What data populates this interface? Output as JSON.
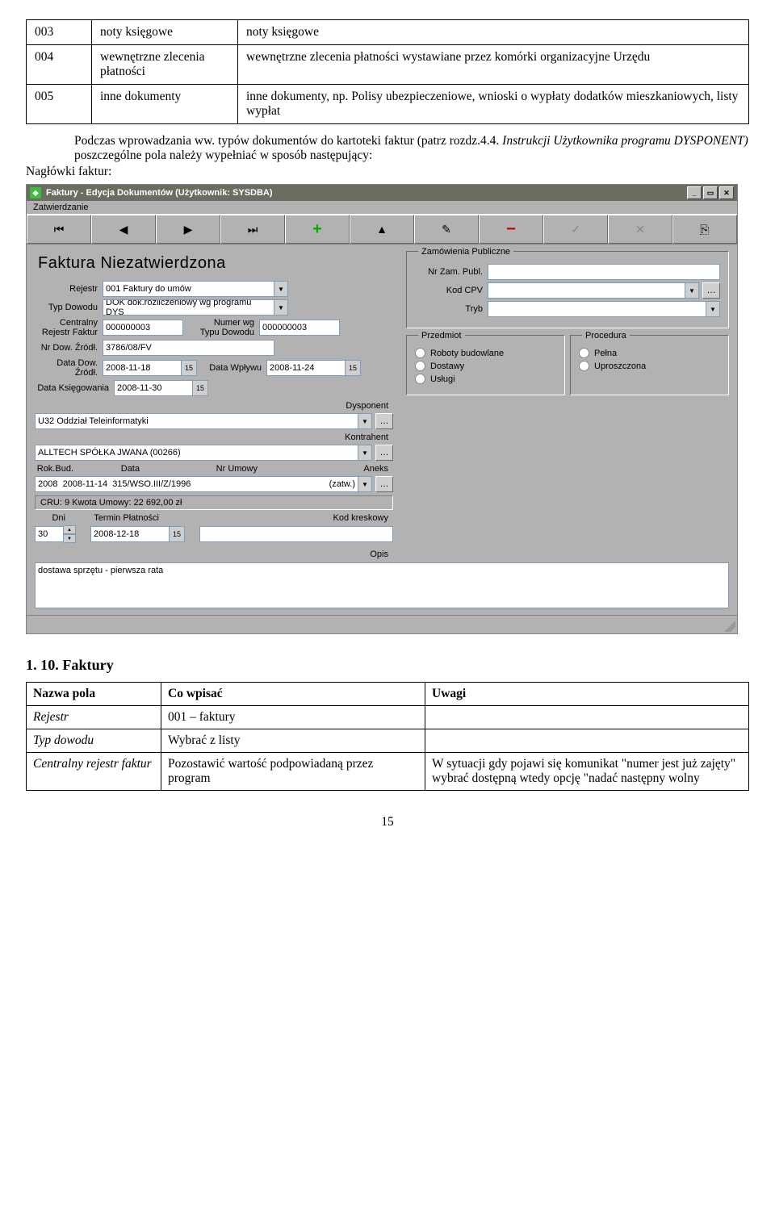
{
  "table1": {
    "rows": [
      {
        "c1": "003",
        "c2": "noty księgowe",
        "c3": "noty księgowe"
      },
      {
        "c1": "004",
        "c2": "wewnętrzne zlecenia płatności",
        "c3": "wewnętrzne zlecenia płatności wystawiane przez komórki organizacyjne Urzędu"
      },
      {
        "c1": "005",
        "c2": "inne dokumenty",
        "c3": "inne dokumenty, np. Polisy ubezpieczeniowe, wnioski o wypłaty dodatków mieszkaniowych, listy wypłat"
      }
    ]
  },
  "para1_a": "Podczas wprowadzania ww. typów dokumentów do kartoteki faktur (patrz rozdz.4.4.",
  "para1_b": "Instrukcji Użytkownika programu DYSPONENT)",
  "para1_c": " poszczególne pola należy wypełniać w sposób następujący:",
  "para2": "Nagłówki faktur:",
  "win": {
    "title": "Faktury - Edycja Dokumentów (Użytkownik: SYSDBA)",
    "menu": "Zatwierdzanie",
    "toolbar": [
      "⏮",
      "◀",
      "▶",
      "⏭",
      "+",
      "▲",
      "✎",
      "−",
      "✓",
      "✕",
      "⎘"
    ],
    "doc_title": "Faktura Niezatwierdzona",
    "labels": {
      "rejestr": "Rejestr",
      "typdow": "Typ Dowodu",
      "crf": "Centralny\nRejestr Faktur",
      "nwtd": "Numer wg\nTypu Dowodu",
      "nrdz": "Nr Dow. Źródł.",
      "ddz": "Data Dow. Źródł.",
      "dw": "Data Wpływu",
      "dk": "Data Księgowania",
      "dysp": "Dysponent",
      "kontr": "Kontrahent",
      "rok": "Rok.Bud.",
      "data": "Data",
      "nrumowy": "Nr Umowy",
      "aneks": "Aneks",
      "dni": "Dni",
      "termin": "Termin Płatności",
      "kod": "Kod kreskowy",
      "opis": "Opis"
    },
    "vals": {
      "rejestr": "001  Faktury do umów",
      "typdow": "DOK dok.rozliczeniowy wg programu DYS",
      "crf": "000000003",
      "nwtd": "000000003",
      "nrdz": "3786/08/FV",
      "ddz": "2008-11-18",
      "dw": "2008-11-24",
      "dk": "2008-11-30",
      "dysp": "U32  Oddział Teleinformatyki",
      "kontr": "ALLTECH   SPÓŁKA JWANA (00266)",
      "rok": "2008",
      "data": "2008-11-14",
      "nrumowy": "315/WSO.III/Z/1996",
      "aneks": "(zatw.)",
      "cru": "CRU: 9  Kwota Umowy: 22 692,00 zł",
      "dni": "30",
      "termin": "2008-12-18",
      "kod": "",
      "opis": "dostawa sprzętu - pierwsza rata"
    },
    "zp": {
      "title": "Zamówienia Publiczne",
      "l_nr": "Nr Zam. Publ.",
      "l_cpv": "Kod CPV",
      "l_tryb": "Tryb",
      "group2_l": "Przedmiot",
      "group2_r": "Procedura",
      "opts_l": [
        "Roboty budowlane",
        "Dostawy",
        "Usługi"
      ],
      "opts_r": [
        "Pełna",
        "Uproszczona"
      ]
    }
  },
  "section_title": "1.      10. Faktury",
  "table2": {
    "header": [
      "Nazwa pola",
      "Co wpisać",
      "Uwagi"
    ],
    "rows": [
      {
        "a": "Rejestr",
        "b": "001 – faktury",
        "c": ""
      },
      {
        "a": "Typ dowodu",
        "b": "Wybrać z listy",
        "c": ""
      },
      {
        "a": "Centralny rejestr faktur",
        "b": "Pozostawić wartość podpowiadaną przez program",
        "c": "W sytuacji gdy pojawi się komunikat \"numer jest już zajęty\" wybrać dostępną wtedy opcję \"nadać następny wolny"
      }
    ]
  },
  "pagenum": "15"
}
